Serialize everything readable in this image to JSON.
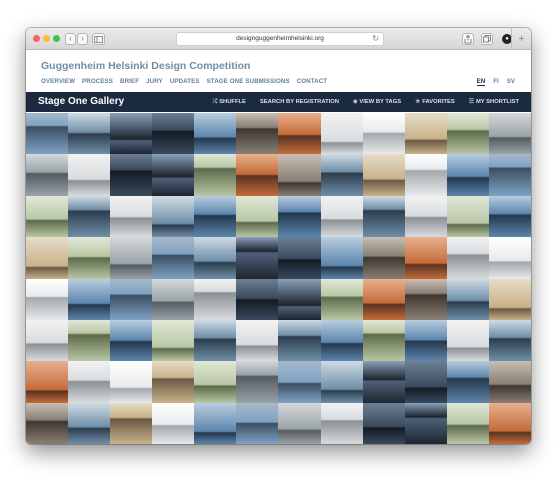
{
  "browser": {
    "url": "designguggenheimhelsinki.org",
    "back_icon": "‹",
    "forward_icon": "›",
    "reload_icon": "↻",
    "new_tab_icon": "+"
  },
  "site": {
    "title": "Guggenheim Helsinki Design Competition",
    "nav": [
      "OVERVIEW",
      "PROCESS",
      "BRIEF",
      "JURY",
      "UPDATES",
      "STAGE ONE SUBMISSIONS",
      "CONTACT"
    ],
    "languages": [
      "EN",
      "FI",
      "SV"
    ],
    "active_language": "EN"
  },
  "gallery": {
    "title": "Stage One Gallery",
    "tools": [
      {
        "icon": "⤮",
        "label": "SHUFFLE"
      },
      {
        "icon": "",
        "label": "SEARCH BY REGISTRATION"
      },
      {
        "icon": "◆",
        "label": "VIEW BY TAGS"
      },
      {
        "icon": "★",
        "label": "FAVORITES"
      },
      {
        "icon": "☰",
        "label": "MY SHORTLIST"
      }
    ]
  },
  "colors": {
    "header_text": "#6f8ea6",
    "gallery_bar": "#1b2a3f"
  }
}
